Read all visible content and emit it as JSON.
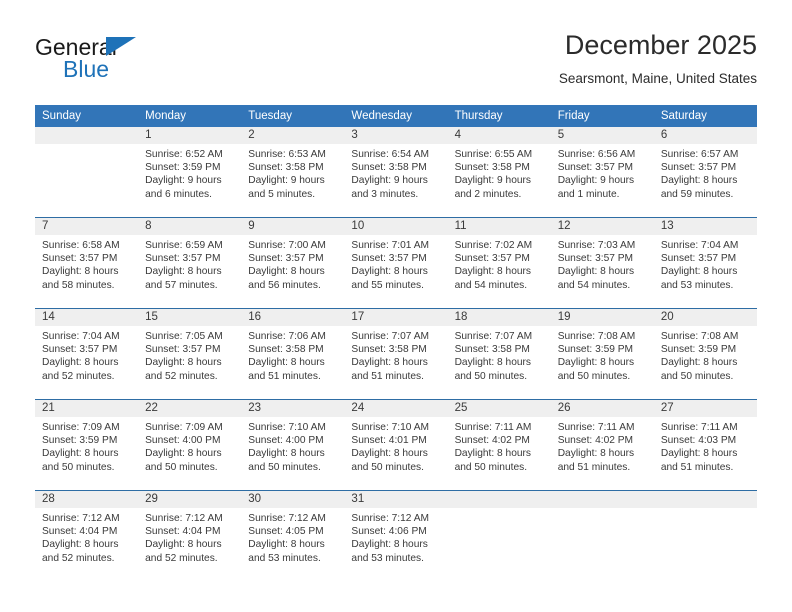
{
  "brand": {
    "name_part1": "General",
    "name_part2": "Blue",
    "accent_color": "#1e72b8"
  },
  "header": {
    "title": "December 2025",
    "subtitle": "Searsmont, Maine, United States"
  },
  "theme": {
    "header_row_bg": "#3275b8",
    "day_number_bg": "#efefef",
    "week_separator": "#2e6da4",
    "text": "#3a3a3a"
  },
  "weekdays": [
    "Sunday",
    "Monday",
    "Tuesday",
    "Wednesday",
    "Thursday",
    "Friday",
    "Saturday"
  ],
  "weeks": [
    [
      {
        "day": "",
        "lines": []
      },
      {
        "day": "1",
        "lines": [
          "Sunrise: 6:52 AM",
          "Sunset: 3:59 PM",
          "Daylight: 9 hours",
          "and 6 minutes."
        ]
      },
      {
        "day": "2",
        "lines": [
          "Sunrise: 6:53 AM",
          "Sunset: 3:58 PM",
          "Daylight: 9 hours",
          "and 5 minutes."
        ]
      },
      {
        "day": "3",
        "lines": [
          "Sunrise: 6:54 AM",
          "Sunset: 3:58 PM",
          "Daylight: 9 hours",
          "and 3 minutes."
        ]
      },
      {
        "day": "4",
        "lines": [
          "Sunrise: 6:55 AM",
          "Sunset: 3:58 PM",
          "Daylight: 9 hours",
          "and 2 minutes."
        ]
      },
      {
        "day": "5",
        "lines": [
          "Sunrise: 6:56 AM",
          "Sunset: 3:57 PM",
          "Daylight: 9 hours",
          "and 1 minute."
        ]
      },
      {
        "day": "6",
        "lines": [
          "Sunrise: 6:57 AM",
          "Sunset: 3:57 PM",
          "Daylight: 8 hours",
          "and 59 minutes."
        ]
      }
    ],
    [
      {
        "day": "7",
        "lines": [
          "Sunrise: 6:58 AM",
          "Sunset: 3:57 PM",
          "Daylight: 8 hours",
          "and 58 minutes."
        ]
      },
      {
        "day": "8",
        "lines": [
          "Sunrise: 6:59 AM",
          "Sunset: 3:57 PM",
          "Daylight: 8 hours",
          "and 57 minutes."
        ]
      },
      {
        "day": "9",
        "lines": [
          "Sunrise: 7:00 AM",
          "Sunset: 3:57 PM",
          "Daylight: 8 hours",
          "and 56 minutes."
        ]
      },
      {
        "day": "10",
        "lines": [
          "Sunrise: 7:01 AM",
          "Sunset: 3:57 PM",
          "Daylight: 8 hours",
          "and 55 minutes."
        ]
      },
      {
        "day": "11",
        "lines": [
          "Sunrise: 7:02 AM",
          "Sunset: 3:57 PM",
          "Daylight: 8 hours",
          "and 54 minutes."
        ]
      },
      {
        "day": "12",
        "lines": [
          "Sunrise: 7:03 AM",
          "Sunset: 3:57 PM",
          "Daylight: 8 hours",
          "and 54 minutes."
        ]
      },
      {
        "day": "13",
        "lines": [
          "Sunrise: 7:04 AM",
          "Sunset: 3:57 PM",
          "Daylight: 8 hours",
          "and 53 minutes."
        ]
      }
    ],
    [
      {
        "day": "14",
        "lines": [
          "Sunrise: 7:04 AM",
          "Sunset: 3:57 PM",
          "Daylight: 8 hours",
          "and 52 minutes."
        ]
      },
      {
        "day": "15",
        "lines": [
          "Sunrise: 7:05 AM",
          "Sunset: 3:57 PM",
          "Daylight: 8 hours",
          "and 52 minutes."
        ]
      },
      {
        "day": "16",
        "lines": [
          "Sunrise: 7:06 AM",
          "Sunset: 3:58 PM",
          "Daylight: 8 hours",
          "and 51 minutes."
        ]
      },
      {
        "day": "17",
        "lines": [
          "Sunrise: 7:07 AM",
          "Sunset: 3:58 PM",
          "Daylight: 8 hours",
          "and 51 minutes."
        ]
      },
      {
        "day": "18",
        "lines": [
          "Sunrise: 7:07 AM",
          "Sunset: 3:58 PM",
          "Daylight: 8 hours",
          "and 50 minutes."
        ]
      },
      {
        "day": "19",
        "lines": [
          "Sunrise: 7:08 AM",
          "Sunset: 3:59 PM",
          "Daylight: 8 hours",
          "and 50 minutes."
        ]
      },
      {
        "day": "20",
        "lines": [
          "Sunrise: 7:08 AM",
          "Sunset: 3:59 PM",
          "Daylight: 8 hours",
          "and 50 minutes."
        ]
      }
    ],
    [
      {
        "day": "21",
        "lines": [
          "Sunrise: 7:09 AM",
          "Sunset: 3:59 PM",
          "Daylight: 8 hours",
          "and 50 minutes."
        ]
      },
      {
        "day": "22",
        "lines": [
          "Sunrise: 7:09 AM",
          "Sunset: 4:00 PM",
          "Daylight: 8 hours",
          "and 50 minutes."
        ]
      },
      {
        "day": "23",
        "lines": [
          "Sunrise: 7:10 AM",
          "Sunset: 4:00 PM",
          "Daylight: 8 hours",
          "and 50 minutes."
        ]
      },
      {
        "day": "24",
        "lines": [
          "Sunrise: 7:10 AM",
          "Sunset: 4:01 PM",
          "Daylight: 8 hours",
          "and 50 minutes."
        ]
      },
      {
        "day": "25",
        "lines": [
          "Sunrise: 7:11 AM",
          "Sunset: 4:02 PM",
          "Daylight: 8 hours",
          "and 50 minutes."
        ]
      },
      {
        "day": "26",
        "lines": [
          "Sunrise: 7:11 AM",
          "Sunset: 4:02 PM",
          "Daylight: 8 hours",
          "and 51 minutes."
        ]
      },
      {
        "day": "27",
        "lines": [
          "Sunrise: 7:11 AM",
          "Sunset: 4:03 PM",
          "Daylight: 8 hours",
          "and 51 minutes."
        ]
      }
    ],
    [
      {
        "day": "28",
        "lines": [
          "Sunrise: 7:12 AM",
          "Sunset: 4:04 PM",
          "Daylight: 8 hours",
          "and 52 minutes."
        ]
      },
      {
        "day": "29",
        "lines": [
          "Sunrise: 7:12 AM",
          "Sunset: 4:04 PM",
          "Daylight: 8 hours",
          "and 52 minutes."
        ]
      },
      {
        "day": "30",
        "lines": [
          "Sunrise: 7:12 AM",
          "Sunset: 4:05 PM",
          "Daylight: 8 hours",
          "and 53 minutes."
        ]
      },
      {
        "day": "31",
        "lines": [
          "Sunrise: 7:12 AM",
          "Sunset: 4:06 PM",
          "Daylight: 8 hours",
          "and 53 minutes."
        ]
      },
      {
        "day": "",
        "lines": []
      },
      {
        "day": "",
        "lines": []
      },
      {
        "day": "",
        "lines": []
      }
    ]
  ]
}
